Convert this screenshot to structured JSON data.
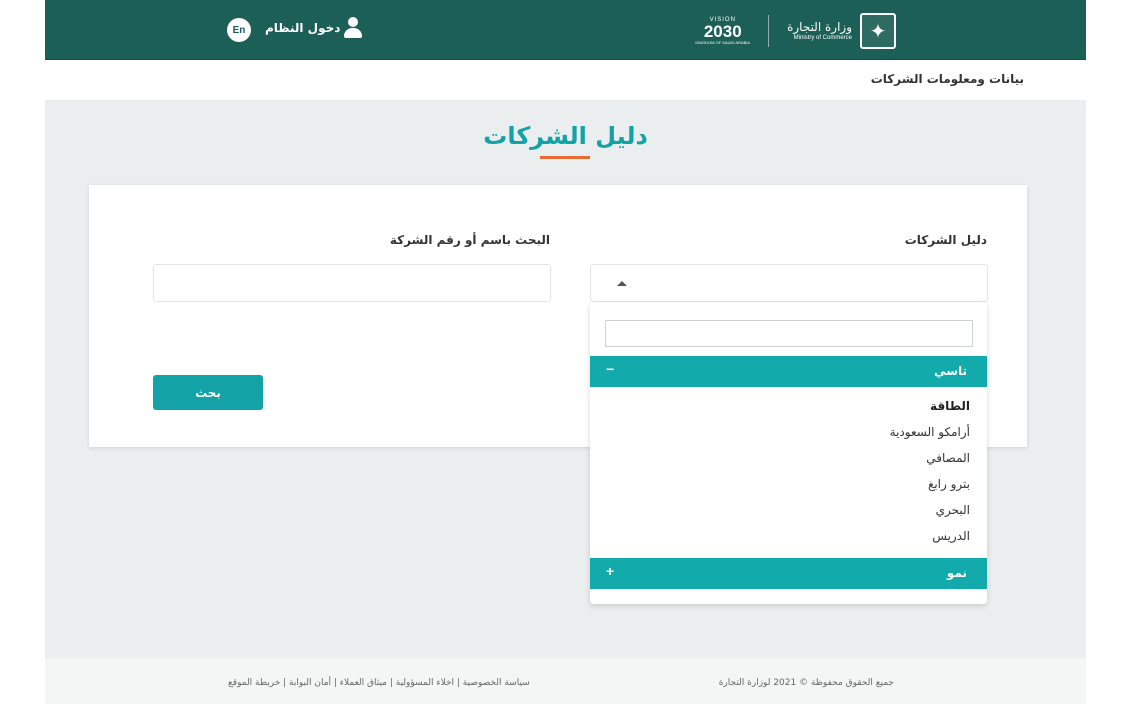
{
  "header": {
    "ministry_ar": "وزارة التجارة",
    "ministry_en": "Ministry of Commerce",
    "vision_label": "VISION",
    "vision_year": "2030",
    "vision_sub": "KINGDOM OF SAUDI ARABIA",
    "login_label": "دخول النظام",
    "lang_label": "En",
    "emblem_icon": "palm-swords-icon",
    "user_icon": "user-icon"
  },
  "breadcrumb": "بيانات ومعلومات الشركات",
  "main": {
    "title": "دليل الشركات",
    "directory_label": "دليل الشركات",
    "search_label": "البحث باسم أو رقم الشركة",
    "search_value": "",
    "button_label": "بحث"
  },
  "dropdown": {
    "search_value": "",
    "groups": [
      {
        "label": "تاسي",
        "toggle": "−",
        "expanded": true,
        "items": [
          "الطاقة",
          "أرامكو السعودية",
          "المصافي",
          "بترو رابغ",
          "البحري",
          "الدريس"
        ]
      },
      {
        "label": "نمو",
        "toggle": "+",
        "expanded": false,
        "items": []
      }
    ]
  },
  "footer": {
    "copyright": "جميع الحقوق محفوظة © 2021 لوزارة التجارة",
    "links": "سياسة الخصوصية | اخلاء المسؤولية | ميثاق العملاء | أمان البوابة | خريطة الموقع"
  },
  "colors": {
    "header_bg": "#1c5f56",
    "accent": "#13a2a6",
    "underline": "#ea6a2f",
    "section_bg": "#ebeeee"
  }
}
